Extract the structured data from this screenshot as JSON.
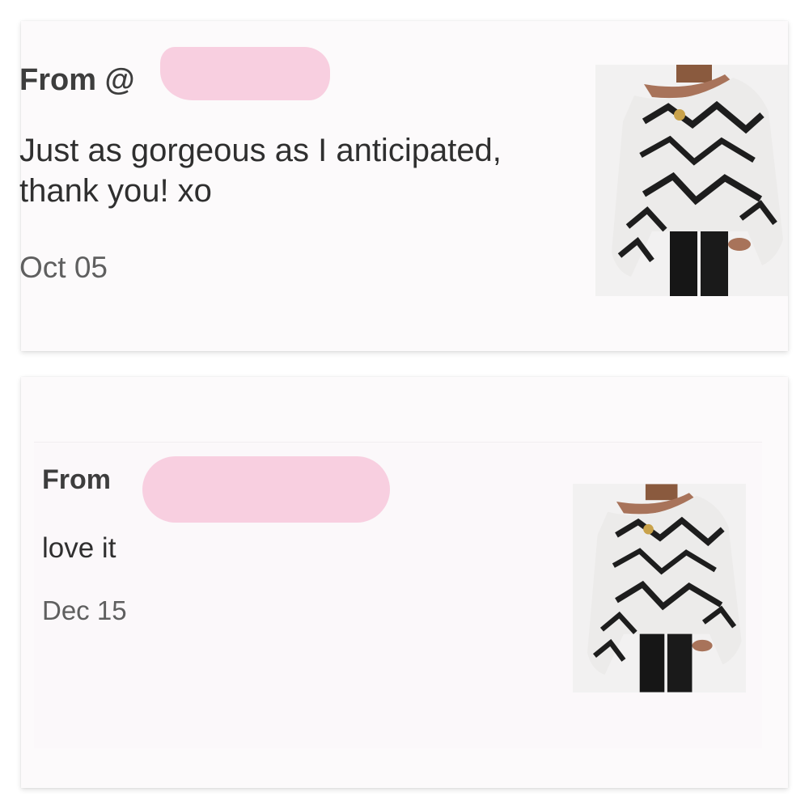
{
  "reviews": [
    {
      "from_label": "From @",
      "message": "Just as gorgeous as I anticipated, thank you! xo",
      "date": "Oct 05",
      "photo_icon": "sweater-photo"
    },
    {
      "from_label": "From",
      "message": "love it",
      "date": "Dec 15",
      "photo_icon": "sweater-photo"
    }
  ],
  "colors": {
    "redaction": "#f8cfe0",
    "card_background": "#fcfafb"
  }
}
